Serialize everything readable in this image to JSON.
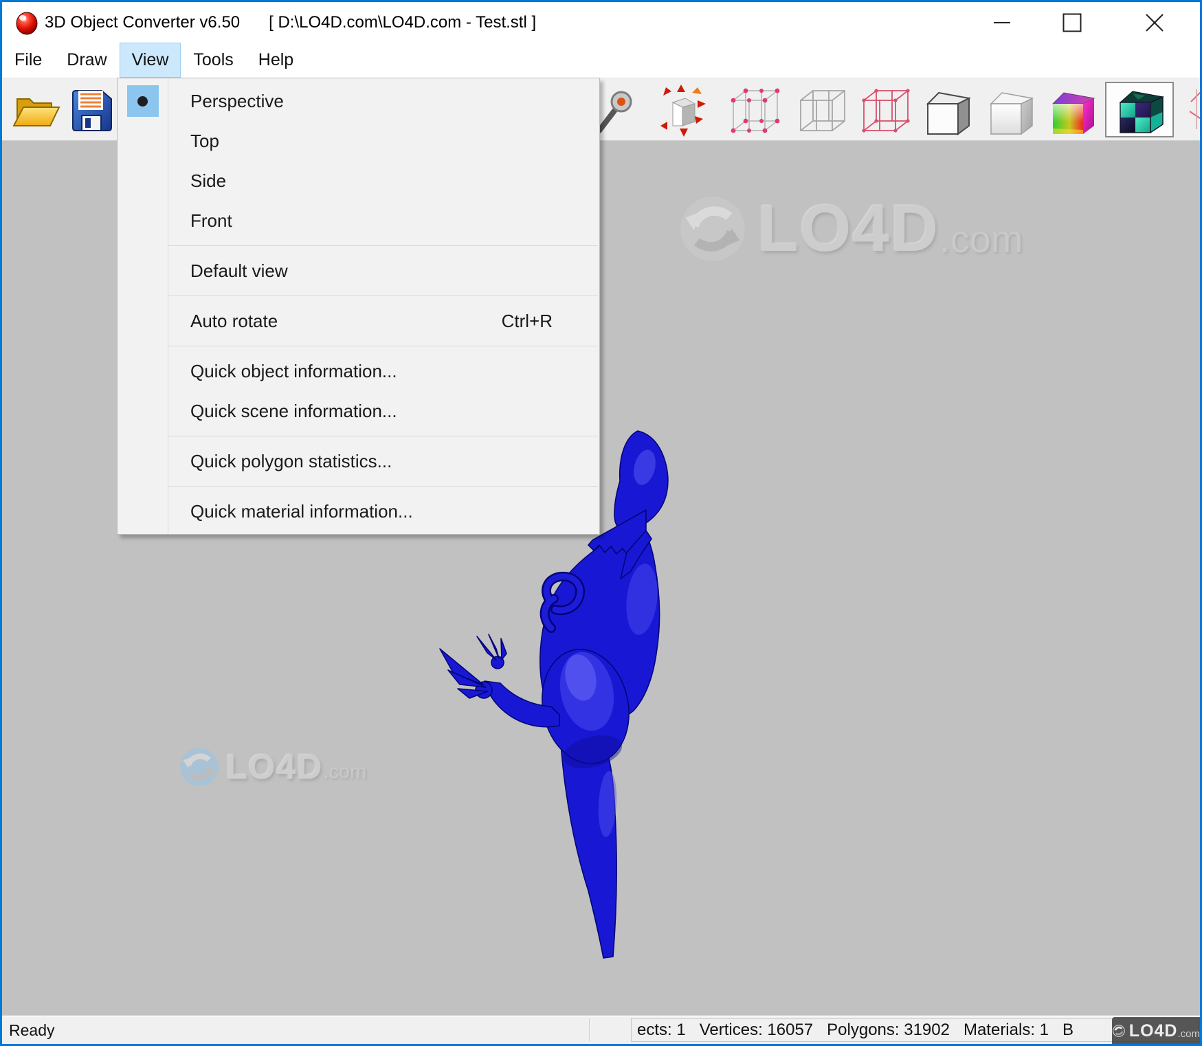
{
  "window": {
    "app_title": "3D Object Converter v6.50",
    "document_path": "[ D:\\LO4D.com\\LO4D.com - Test.stl ]"
  },
  "menubar": {
    "items": [
      {
        "label": "File"
      },
      {
        "label": "Draw"
      },
      {
        "label": "View",
        "active": true
      },
      {
        "label": "Tools"
      },
      {
        "label": "Help"
      }
    ]
  },
  "view_menu": {
    "items": [
      {
        "label": "Perspective",
        "radio_selected": true
      },
      {
        "label": "Top"
      },
      {
        "label": "Side"
      },
      {
        "label": "Front"
      },
      {
        "label": "Default view"
      },
      {
        "label": "Auto rotate",
        "shortcut": "Ctrl+R"
      },
      {
        "label": "Quick object information..."
      },
      {
        "label": "Quick scene information..."
      },
      {
        "label": "Quick polygon statistics..."
      },
      {
        "label": "Quick material information..."
      }
    ]
  },
  "toolbar": {
    "icons": [
      "open-file",
      "save-file",
      "pick-pin",
      "explode-normals-cube",
      "vertex-wireframe-cube",
      "wireframe-cube",
      "red-wireframe-cube",
      "flat-shaded-cube",
      "smooth-shaded-cube",
      "gradient-colored-cube",
      "textured-checker-cube",
      "axis-partial"
    ],
    "selected_icon": "textured-checker-cube"
  },
  "statusbar": {
    "left": "Ready",
    "info": "ects: 1   Vertices: 16057   Polygons: 31902   Materials: 1   B"
  },
  "watermark": {
    "name": "LO4D",
    "tld": ".com"
  },
  "model": {
    "name": "blue-trex-model",
    "color": "#1818d4"
  },
  "colors": {
    "window_border": "#0078d7",
    "canvas": "#c1c1c1",
    "menu_highlight": "#cbe8fc",
    "radio_square": "#8cc5ee",
    "menu_bg": "#f2f2f2"
  }
}
